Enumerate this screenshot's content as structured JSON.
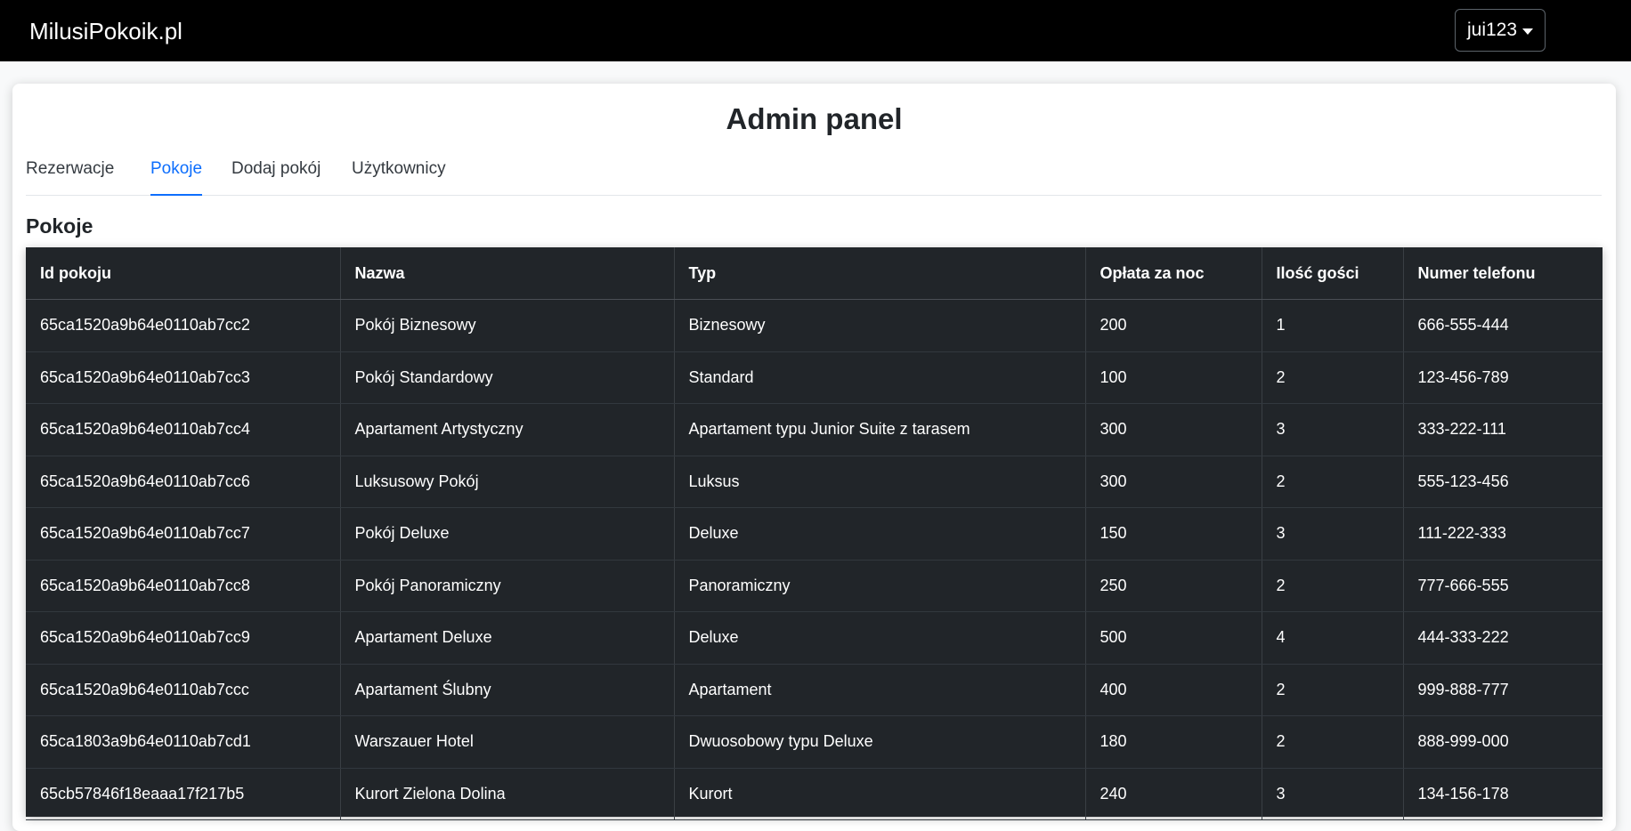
{
  "navbar": {
    "brand": "MilusiPokoik.pl",
    "user": "jui123"
  },
  "page": {
    "title": "Admin panel",
    "tabs": [
      {
        "label": "Rezerwacje",
        "active": false
      },
      {
        "label": "Pokoje",
        "active": true
      },
      {
        "label": "Dodaj pokój",
        "active": false
      },
      {
        "label": "Użytkownicy",
        "active": false
      }
    ],
    "section_title": "Pokoje"
  },
  "table": {
    "headers": [
      "Id pokoju",
      "Nazwa",
      "Typ",
      "Opłata za noc",
      "Ilość gości",
      "Numer telefonu"
    ],
    "rows": [
      [
        "65ca1520a9b64e0110ab7cc2",
        "Pokój Biznesowy",
        "Biznesowy",
        "200",
        "1",
        "666-555-444"
      ],
      [
        "65ca1520a9b64e0110ab7cc3",
        "Pokój Standardowy",
        "Standard",
        "100",
        "2",
        "123-456-789"
      ],
      [
        "65ca1520a9b64e0110ab7cc4",
        "Apartament Artystyczny",
        "Apartament typu Junior Suite z tarasem",
        "300",
        "3",
        "333-222-111"
      ],
      [
        "65ca1520a9b64e0110ab7cc6",
        "Luksusowy Pokój",
        "Luksus",
        "300",
        "2",
        "555-123-456"
      ],
      [
        "65ca1520a9b64e0110ab7cc7",
        "Pokój Deluxe",
        "Deluxe",
        "150",
        "3",
        "111-222-333"
      ],
      [
        "65ca1520a9b64e0110ab7cc8",
        "Pokój Panoramiczny",
        "Panoramiczny",
        "250",
        "2",
        "777-666-555"
      ],
      [
        "65ca1520a9b64e0110ab7cc9",
        "Apartament Deluxe",
        "Deluxe",
        "500",
        "4",
        "444-333-222"
      ],
      [
        "65ca1520a9b64e0110ab7ccc",
        "Apartament Ślubny",
        "Apartament",
        "400",
        "2",
        "999-888-777"
      ],
      [
        "65ca1803a9b64e0110ab7cd1",
        "Warszauer Hotel",
        "Dwuosobowy typu Deluxe",
        "180",
        "2",
        "888-999-000"
      ],
      [
        "65cb57846f18eaaa17f217b5",
        "Kurort Zielona Dolina",
        "Kurort",
        "240",
        "3",
        "134-156-178"
      ]
    ]
  },
  "colors": {
    "navbar_bg": "#000000",
    "table_bg": "#212529",
    "accent": "#0d6efd"
  }
}
